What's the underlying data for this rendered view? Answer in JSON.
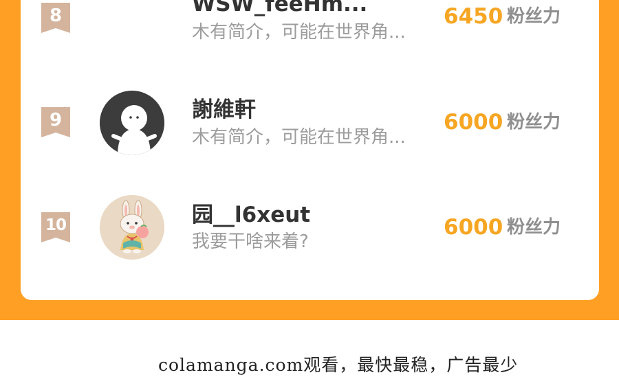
{
  "ranking": {
    "rows": [
      {
        "rank": "8",
        "name": "WSW_feeHm...",
        "intro": "木有简介，可能在世界角...",
        "score": "6450",
        "score_unit": "粉丝力"
      },
      {
        "rank": "9",
        "name": "謝維軒",
        "intro": "木有简介，可能在世界角...",
        "score": "6000",
        "score_unit": "粉丝力",
        "avatar": "default-person-icon"
      },
      {
        "rank": "10",
        "name": "园__l6xeut",
        "intro": "我要干啥来着?",
        "score": "6000",
        "score_unit": "粉丝力",
        "avatar": "rabbit-illustration"
      }
    ]
  },
  "footer": {
    "text": "colamanga.com观看，最快最稳，广告最少"
  },
  "colors": {
    "band": "#ff9f24",
    "score": "#f6a623",
    "badge": "#d4b49d"
  }
}
